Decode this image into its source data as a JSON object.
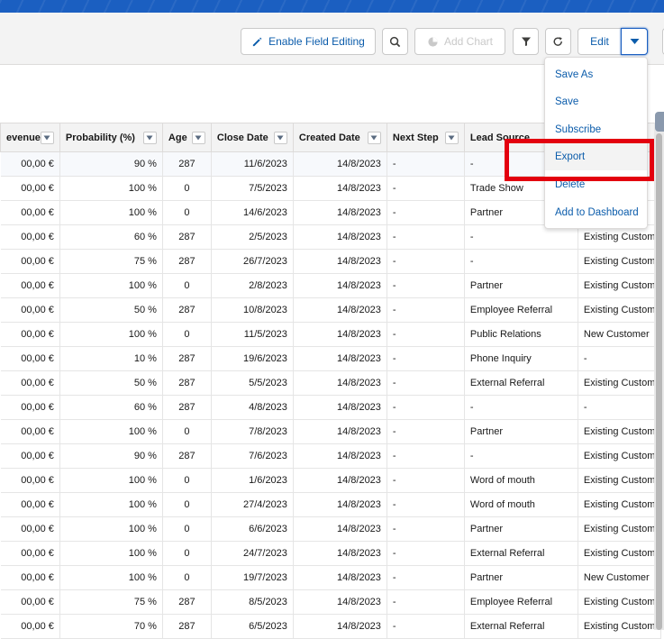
{
  "toolbar": {
    "enable_field_editing": "Enable Field Editing",
    "add_chart": "Add Chart",
    "edit": "Edit"
  },
  "table": {
    "columns": [
      "evenue",
      "Probability (%)",
      "Age",
      "Close Date",
      "Created Date",
      "Next Step",
      "Lead Source",
      ""
    ],
    "rows": [
      [
        "00,00 €",
        "90 %",
        "287",
        "11/6/2023",
        "14/8/2023",
        "-",
        "-",
        ""
      ],
      [
        "00,00 €",
        "100 %",
        "0",
        "7/5/2023",
        "14/8/2023",
        "-",
        "Trade Show",
        ""
      ],
      [
        "00,00 €",
        "100 %",
        "0",
        "14/6/2023",
        "14/8/2023",
        "-",
        "Partner",
        ""
      ],
      [
        "00,00 €",
        "60 %",
        "287",
        "2/5/2023",
        "14/8/2023",
        "-",
        "-",
        "Existing Custom"
      ],
      [
        "00,00 €",
        "75 %",
        "287",
        "26/7/2023",
        "14/8/2023",
        "-",
        "-",
        "Existing Custom"
      ],
      [
        "00,00 €",
        "100 %",
        "0",
        "2/8/2023",
        "14/8/2023",
        "-",
        "Partner",
        "Existing Custom"
      ],
      [
        "00,00 €",
        "50 %",
        "287",
        "10/8/2023",
        "14/8/2023",
        "-",
        "Employee Referral",
        "Existing Custom"
      ],
      [
        "00,00 €",
        "100 %",
        "0",
        "11/5/2023",
        "14/8/2023",
        "-",
        "Public Relations",
        "New Customer"
      ],
      [
        "00,00 €",
        "10 %",
        "287",
        "19/6/2023",
        "14/8/2023",
        "-",
        "Phone Inquiry",
        "-"
      ],
      [
        "00,00 €",
        "50 %",
        "287",
        "5/5/2023",
        "14/8/2023",
        "-",
        "External Referral",
        "Existing Custom"
      ],
      [
        "00,00 €",
        "60 %",
        "287",
        "4/8/2023",
        "14/8/2023",
        "-",
        "-",
        "-"
      ],
      [
        "00,00 €",
        "100 %",
        "0",
        "7/8/2023",
        "14/8/2023",
        "-",
        "Partner",
        "Existing Custom"
      ],
      [
        "00,00 €",
        "90 %",
        "287",
        "7/6/2023",
        "14/8/2023",
        "-",
        "-",
        "Existing Custom"
      ],
      [
        "00,00 €",
        "100 %",
        "0",
        "1/6/2023",
        "14/8/2023",
        "-",
        "Word of mouth",
        "Existing Custom"
      ],
      [
        "00,00 €",
        "100 %",
        "0",
        "27/4/2023",
        "14/8/2023",
        "-",
        "Word of mouth",
        "Existing Custom"
      ],
      [
        "00,00 €",
        "100 %",
        "0",
        "6/6/2023",
        "14/8/2023",
        "-",
        "Partner",
        "Existing Custom"
      ],
      [
        "00,00 €",
        "100 %",
        "0",
        "24/7/2023",
        "14/8/2023",
        "-",
        "External Referral",
        "Existing Custom"
      ],
      [
        "00,00 €",
        "100 %",
        "0",
        "19/7/2023",
        "14/8/2023",
        "-",
        "Partner",
        "New Customer"
      ],
      [
        "00,00 €",
        "75 %",
        "287",
        "8/5/2023",
        "14/8/2023",
        "-",
        "Employee Referral",
        "Existing Custom"
      ],
      [
        "00,00 €",
        "70 %",
        "287",
        "6/5/2023",
        "14/8/2023",
        "-",
        "External Referral",
        "Existing Custom"
      ]
    ]
  },
  "menu": {
    "items": [
      "Save As",
      "Save",
      "Subscribe",
      "Export",
      "Delete",
      "Add to Dashboard"
    ],
    "hovered": "Export"
  },
  "colors": {
    "accent": "#0b5cab",
    "highlight": "#e3000f",
    "header_band": "#1b5fc1"
  }
}
